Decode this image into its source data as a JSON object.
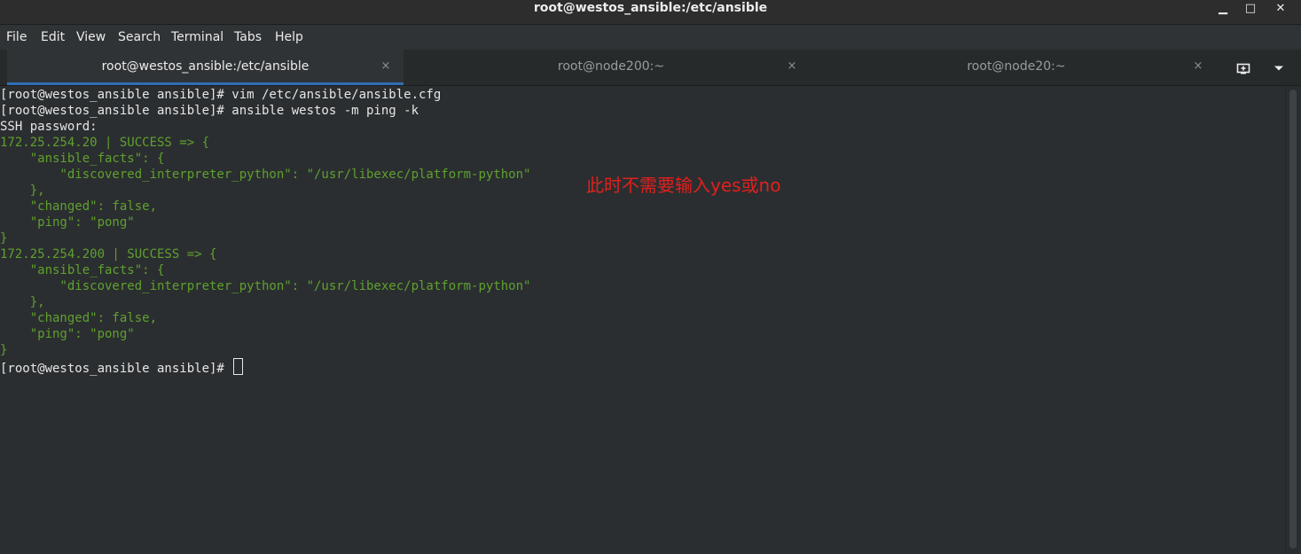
{
  "window": {
    "title": "root@westos_ansible:/etc/ansible",
    "minimize_symbol": "▁",
    "maximize_symbol": "□",
    "close_symbol": "✕"
  },
  "menu": [
    "File",
    "Edit",
    "View",
    "Search",
    "Terminal",
    "Tabs",
    "Help"
  ],
  "tabs": [
    {
      "label": "root@westos_ansible:/etc/ansible",
      "active": true,
      "close": "×"
    },
    {
      "label": "root@node200:~",
      "active": false,
      "close": "×"
    },
    {
      "label": "root@node20:~",
      "active": false,
      "close": "×"
    }
  ],
  "tab_tools": {
    "new_tab_icon": "new-tab-icon",
    "menu_icon": "chevron-down-icon"
  },
  "terminal": {
    "lines": [
      {
        "text": "[root@westos_ansible ansible]# vim /etc/ansible/ansible.cfg",
        "color": "fg"
      },
      {
        "text": "[root@westos_ansible ansible]# ansible westos -m ping -k",
        "color": "fg"
      },
      {
        "text": "SSH password: ",
        "color": "fg"
      },
      {
        "text": "172.25.254.20 | SUCCESS => {",
        "color": "green"
      },
      {
        "text": "    \"ansible_facts\": {",
        "color": "green"
      },
      {
        "text": "        \"discovered_interpreter_python\": \"/usr/libexec/platform-python\"",
        "color": "green"
      },
      {
        "text": "    },",
        "color": "green"
      },
      {
        "text": "    \"changed\": false,",
        "color": "green"
      },
      {
        "text": "    \"ping\": \"pong\"",
        "color": "green"
      },
      {
        "text": "}",
        "color": "green"
      },
      {
        "text": "172.25.254.200 | SUCCESS => {",
        "color": "green"
      },
      {
        "text": "    \"ansible_facts\": {",
        "color": "green"
      },
      {
        "text": "        \"discovered_interpreter_python\": \"/usr/libexec/platform-python\"",
        "color": "green"
      },
      {
        "text": "    },",
        "color": "green"
      },
      {
        "text": "    \"changed\": false,",
        "color": "green"
      },
      {
        "text": "    \"ping\": \"pong\"",
        "color": "green"
      },
      {
        "text": "}",
        "color": "green"
      },
      {
        "text": "[root@westos_ansible ansible]# ",
        "color": "fg",
        "cursor": true
      }
    ]
  },
  "annotation": "此时不需要输入yes或no",
  "colors": {
    "background": "#2b2e30",
    "foreground": "#e6e6e6",
    "success_green": "#5fa02f",
    "annotation_red": "#e0201e",
    "tab_accent": "#2e6fb5"
  }
}
